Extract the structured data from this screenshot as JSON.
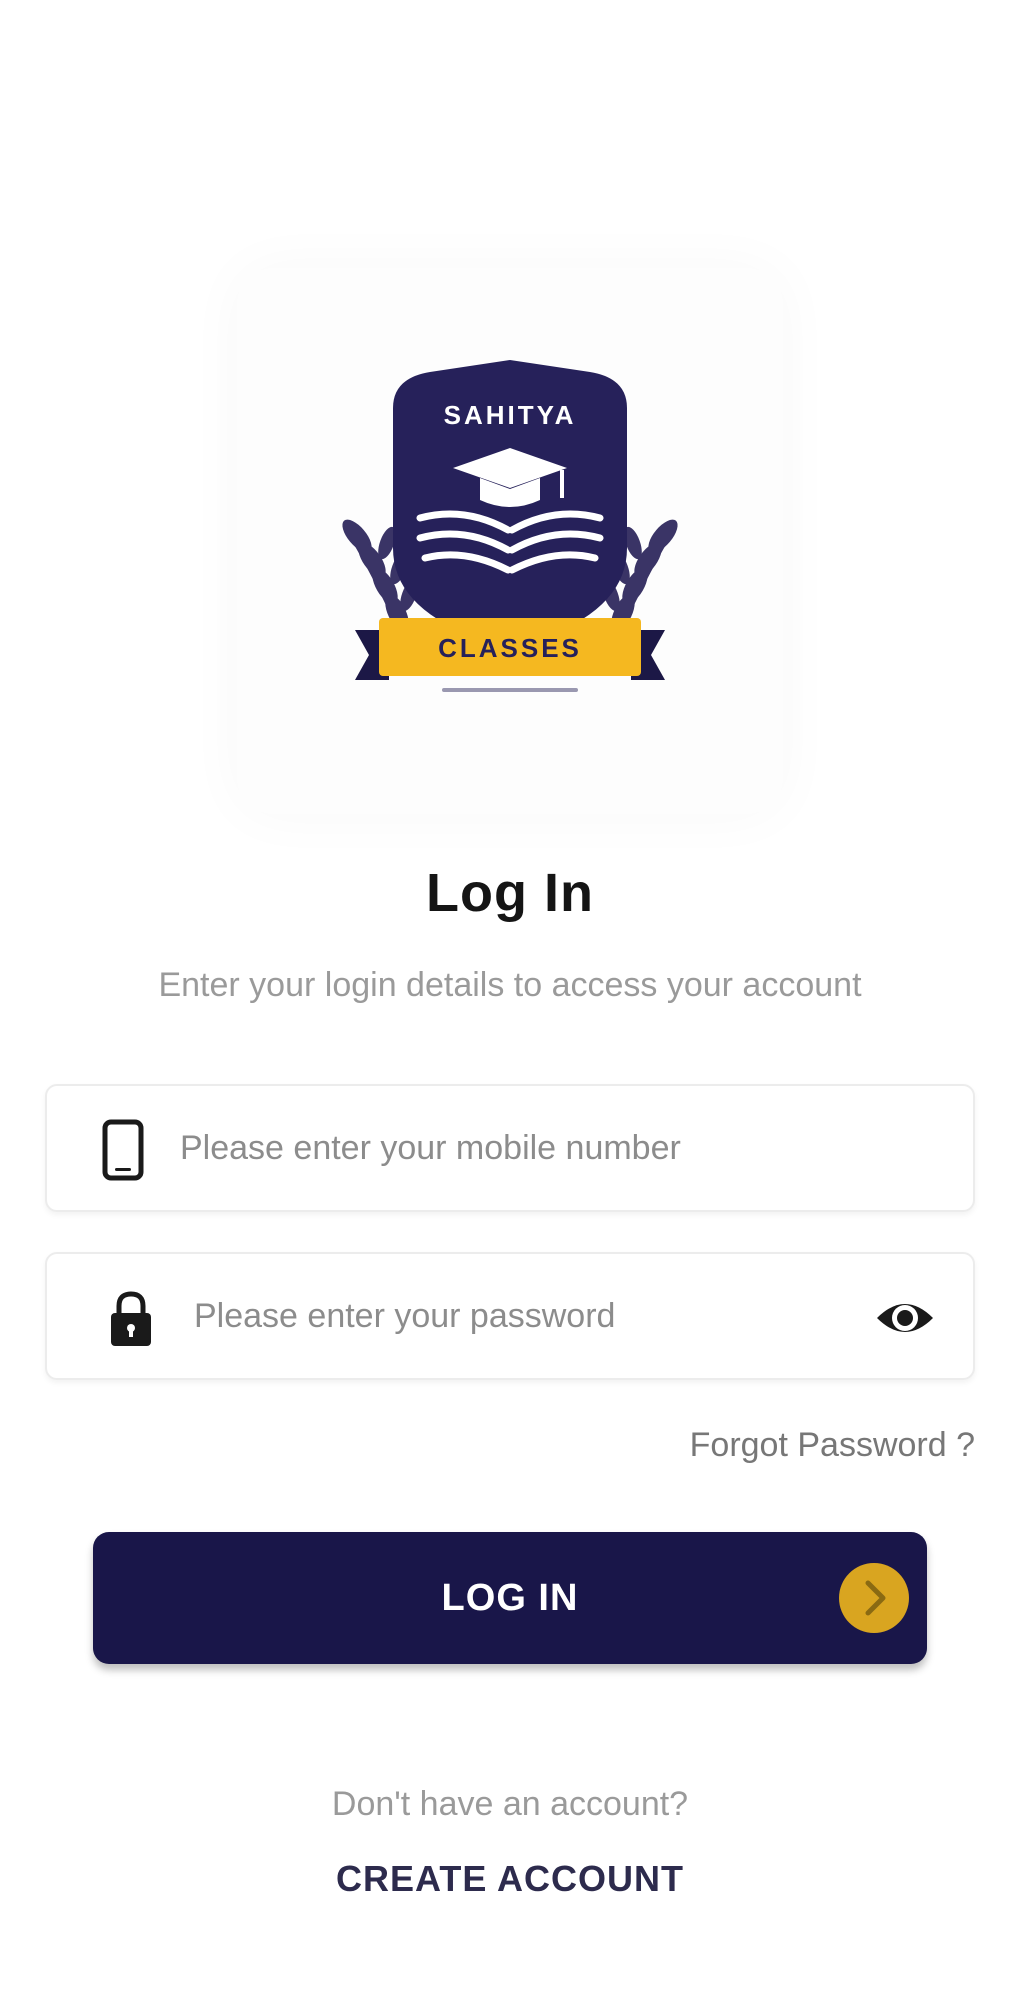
{
  "logo": {
    "top_text": "SAHITYA",
    "banner_text": "CLASSES",
    "colors": {
      "navy": "#26215a",
      "gold": "#f5b820"
    }
  },
  "header": {
    "title": "Log In",
    "subtitle": "Enter your login details to access your account"
  },
  "form": {
    "mobile": {
      "placeholder": "Please enter your mobile number",
      "value": "",
      "icon": "smartphone-icon"
    },
    "password": {
      "placeholder": "Please enter your password",
      "value": "",
      "icon": "lock-icon",
      "toggle_icon": "eye-icon"
    },
    "forgot_label": "Forgot Password ?"
  },
  "login_button": {
    "label": "LOG IN",
    "icon": "chevron-right-icon",
    "color": "#191649",
    "accent": "#d9a520"
  },
  "footer": {
    "prompt": "Don't have an account?",
    "create_label": "CREATE ACCOUNT"
  }
}
